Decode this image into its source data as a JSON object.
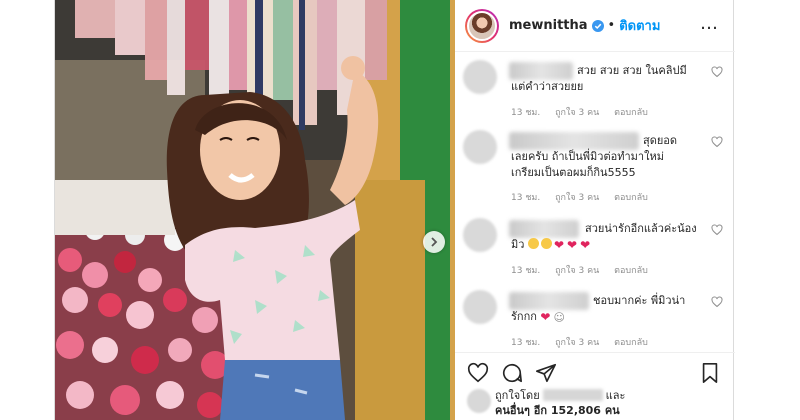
{
  "header": {
    "username": "mewnittha",
    "separator": "•",
    "follow_label": "ติดตาม",
    "more_icon": "…"
  },
  "comments": [
    {
      "text_line1": "สวย สวย สวย ในคลิปมี",
      "text_line2": "แต่คำว่าสวยยย",
      "time": "13 ชม.",
      "likes": "ถูกใจ 3 คน",
      "reply": "ตอบกลับ"
    },
    {
      "text_line1": "สุดยอด",
      "text_line2": "เลยครับ ถ้าเป็นพี่มิวต่อทำมาใหม่",
      "text_line3": "เกรียมเป็นตอผมก็กิน5555",
      "time": "13 ชม.",
      "likes": "ถูกใจ 3 คน",
      "reply": "ตอบกลับ"
    },
    {
      "text_line1": "สวยน่ารักอีกแล้วค่ะน้อง",
      "text_line2": "มิว",
      "time": "13 ชม.",
      "likes": "ถูกใจ 3 คน",
      "reply": "ตอบกลับ"
    },
    {
      "text_line1": "ชอบมากค่ะ พี่มิวน่า",
      "text_line2": "รักกก",
      "time": "13 ชม.",
      "likes": "ถูกใจ 3 คน",
      "reply": "ตอบกลับ"
    }
  ],
  "likes": {
    "liked_by": "ถูกใจโดย",
    "and": "และ",
    "others_prefix": "คนอื่นๆ อีก",
    "count": "152,806",
    "people": "คน"
  },
  "colors": {
    "accent": "#0095f6",
    "heart": "#e0245e",
    "muted": "#8e8e8e"
  },
  "icons": [
    "verified-badge-icon",
    "more-options-icon",
    "heart-icon",
    "comment-icon",
    "share-icon",
    "bookmark-icon",
    "carousel-next-icon"
  ]
}
